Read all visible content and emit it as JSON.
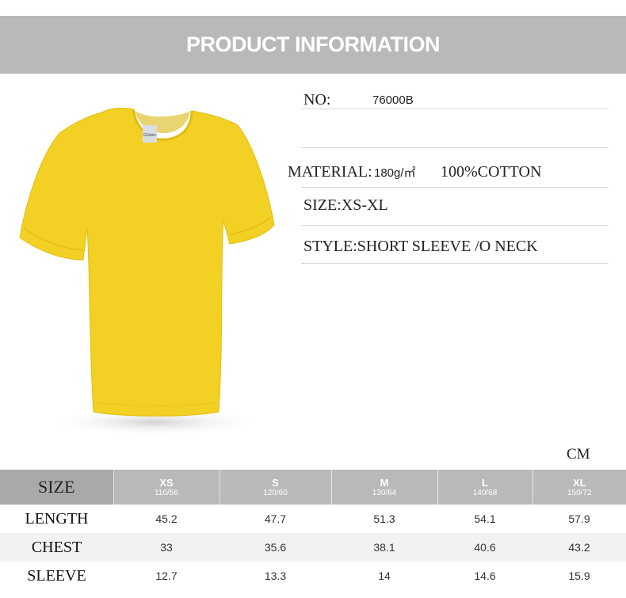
{
  "banner": {
    "title": "PRODUCT INFORMATION"
  },
  "product": {
    "no_label": "NO:",
    "no_value": "76000B",
    "material_label": "MATERIAL:",
    "material_weight": "180g/㎡",
    "material_fabric": "100%COTTON",
    "size_label": "SIZE:XS-XL",
    "style_label": "STYLE:SHORT SLEEVE /O NECK",
    "shirt_color": "#f2d024",
    "shirt_tag_text": "Gildan"
  },
  "table": {
    "unit": "CM",
    "header_label": "SIZE",
    "sizes": [
      {
        "code": "XS",
        "sub": "110/56"
      },
      {
        "code": "S",
        "sub": "120/60"
      },
      {
        "code": "M",
        "sub": "130/64"
      },
      {
        "code": "L",
        "sub": "140/68"
      },
      {
        "code": "XL",
        "sub": "150/72"
      }
    ],
    "rows": [
      {
        "label": "LENGTH",
        "values": [
          "45.2",
          "47.7",
          "51.3",
          "54.1",
          "57.9"
        ]
      },
      {
        "label": "CHEST",
        "values": [
          "33",
          "35.6",
          "38.1",
          "40.6",
          "43.2"
        ]
      },
      {
        "label": "SLEEVE",
        "values": [
          "12.7",
          "13.3",
          "14",
          "14.6",
          "15.9"
        ]
      }
    ]
  }
}
